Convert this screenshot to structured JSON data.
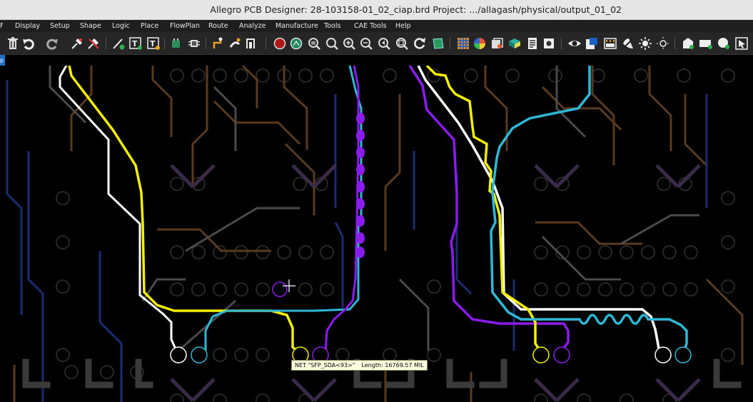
{
  "window": {
    "title": "Allegro PCB Designer: 28-103158-01_02_ciap.brd  Project: .../allagash/physical/output_01_02"
  },
  "menu": {
    "items": [
      {
        "label": "Display"
      },
      {
        "label": "Setup"
      },
      {
        "label": "Shape"
      },
      {
        "label": "Logic"
      },
      {
        "label": "Place"
      },
      {
        "label": "FlowPlan"
      },
      {
        "label": "Route"
      },
      {
        "label": "Analyze"
      },
      {
        "label": "Manufacture"
      },
      {
        "label": "Tools"
      },
      {
        "label": "CAE Tools"
      },
      {
        "label": "Help"
      }
    ]
  },
  "toolbar": {
    "icons": [
      "delete-icon",
      "undo-icon",
      "redo-icon",
      "pin-icon",
      "unpin-icon",
      "add-line-icon",
      "add-text-icon",
      "edit-text-icon",
      "place-component-icon",
      "chip-icon",
      "add-connect-icon",
      "slide-icon",
      "swap-icon",
      "drc-circle-icon",
      "zoom-fit-icon",
      "zoom-world-icon",
      "zoom-icon",
      "zoom-in-icon",
      "zoom-out-icon",
      "zoom-previous-icon",
      "zoom-sheet-icon",
      "redraw-icon",
      "shape-icon",
      "grid-icon",
      "color-icon",
      "layer-icon",
      "3d-icon",
      "report-icon",
      "property-icon",
      "visibility-icon",
      "film-icon",
      "cross-section-icon",
      "shade-icon",
      "highlight-icon",
      "dehighlight-icon",
      "component-icon",
      "display-icon",
      "measure-icon",
      "select-icon"
    ]
  },
  "side_tab": {
    "label": "p"
  },
  "canvas": {
    "tooltip": {
      "net": "NET \"SFP_SDA<93>\"",
      "length": "Length: 16769.57 MIL"
    },
    "colors": {
      "yellow": "#f4f000",
      "white": "#ffffff",
      "cyan": "#2fb8d6",
      "purple": "#8a1cf0",
      "brown": "#5a3a1e",
      "gray": "#555555",
      "navy": "#1c2a6e",
      "pad_ring": "#2e2e2e"
    }
  }
}
